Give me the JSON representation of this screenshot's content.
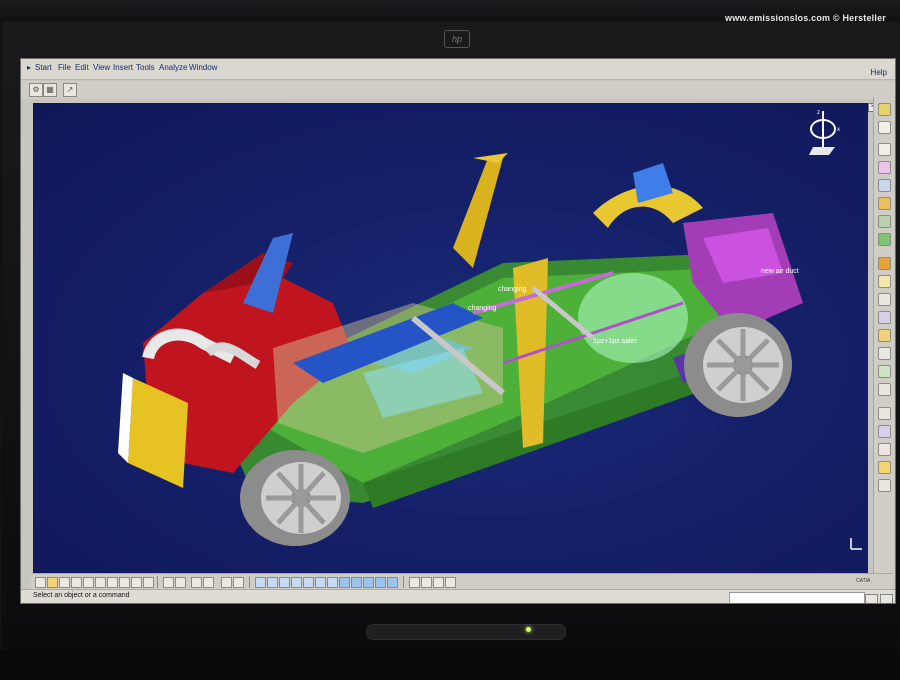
{
  "watermark": "www.emissionslos.com © Hersteller",
  "monitor": {
    "brand": "hp"
  },
  "menu": {
    "items": [
      "Start",
      "File",
      "Edit",
      "View",
      "Insert",
      "Tools",
      "Analyze",
      "Window"
    ],
    "help": "Help"
  },
  "viewport": {
    "background": "#15206a",
    "labels": [
      "changing",
      "changing",
      "new air duct",
      "1pz+1pz saler"
    ]
  },
  "axis_labels": {
    "x": "x",
    "z": "z"
  },
  "brand_mark": "CATIA",
  "status": {
    "prompt": "Select an object or a command",
    "value": ""
  },
  "colors": {
    "accent": "#15306c",
    "chrome": "#cfcdc5"
  }
}
